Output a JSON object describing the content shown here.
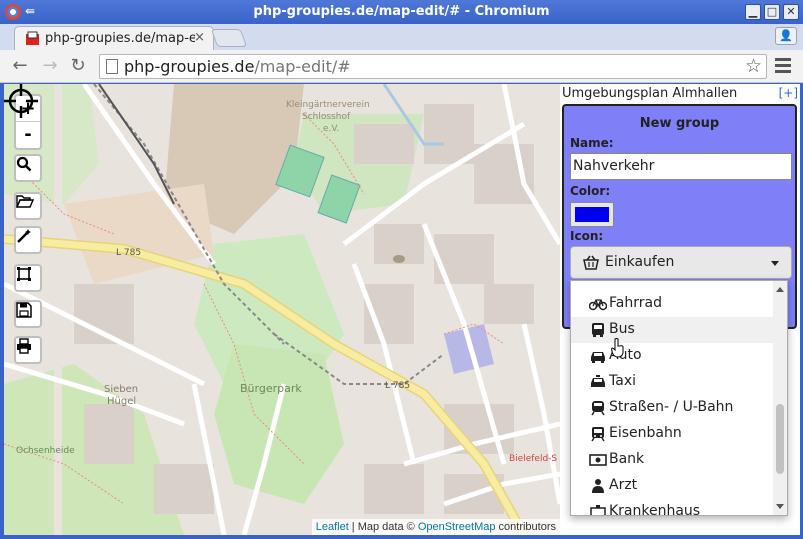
{
  "window": {
    "title": "php-groupies.de/map-edit/# - Chromium"
  },
  "tab": {
    "title": "php-groupies.de/map-e",
    "close": "×"
  },
  "address_bar": {
    "host": "php-groupies.de",
    "path": "/map-edit/#"
  },
  "map": {
    "zoom_in": "+",
    "zoom_out": "-",
    "labels": {
      "kleingarten": "Kleingärtnerverein",
      "schlosshof": "Schlosshof",
      "ev": "e.V.",
      "l785_a": "L 785",
      "l785_b": "L 785",
      "buergerpark": "Bürgerpark",
      "sieben": "Sieben",
      "huegel": "Hügel",
      "ochsenheide": "Ochsenheide",
      "bielefeld": "Bielefeld-S"
    },
    "attribution": {
      "leaflet": "Leaflet",
      "sep": " | Map data © ",
      "osm": "OpenStreetMap",
      "contrib": " contributors"
    }
  },
  "sidebar": {
    "plan_title": "Umgebungsplan Almhallen",
    "add_plan": "[+]",
    "new_group": {
      "heading": "New group",
      "name_label": "Name:",
      "name_value": "Nahverkehr",
      "color_label": "Color:",
      "color_value": "#0000ee",
      "icon_label": "Icon:",
      "icon_selected": "Einkaufen",
      "icon_selected_icon": "shopping-basket-icon"
    },
    "icon_options": [
      {
        "label": "Fahrrad",
        "icon": "bicycle-icon"
      },
      {
        "label": "Bus",
        "icon": "bus-icon"
      },
      {
        "label": "Auto",
        "icon": "car-icon"
      },
      {
        "label": "Taxi",
        "icon": "taxi-icon"
      },
      {
        "label": "Straßen- / U-Bahn",
        "icon": "subway-icon"
      },
      {
        "label": "Eisenbahn",
        "icon": "train-icon"
      },
      {
        "label": "Bank",
        "icon": "money-icon"
      },
      {
        "label": "Arzt",
        "icon": "doctor-icon"
      },
      {
        "label": "Krankenhaus",
        "icon": "hospital-icon"
      }
    ],
    "hovered_option": "Bus"
  },
  "colors": {
    "titlebar": "#3a63c8",
    "panel_bg": "#7f7ff8",
    "map_bg": "#e8e4dd",
    "road_yellow": "#f5e79a",
    "green": "#c8e6b4"
  }
}
